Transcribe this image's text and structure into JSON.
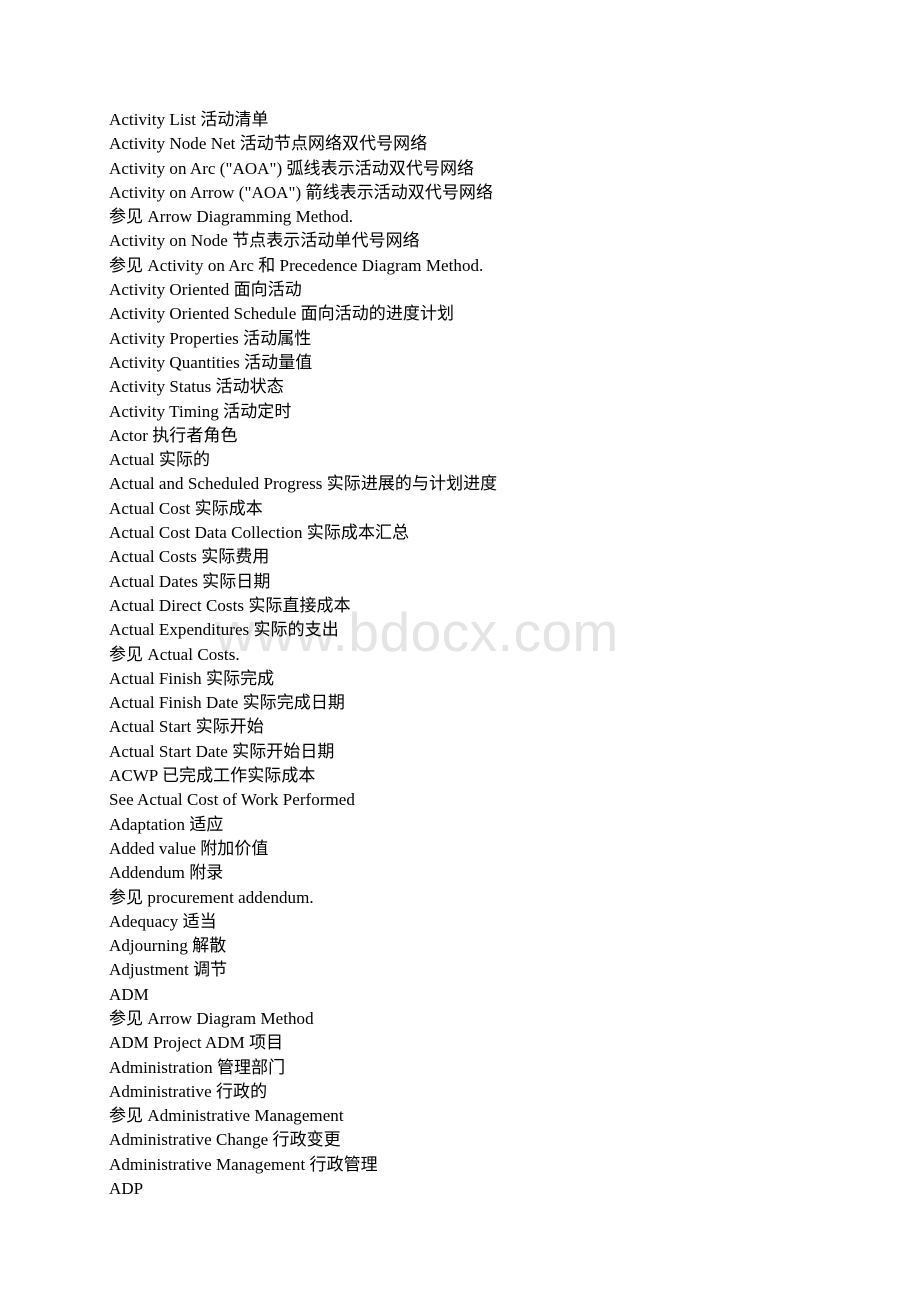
{
  "document": {
    "type": "bilingual-glossary",
    "language_pair": "English-Chinese",
    "section_letter": "A"
  },
  "watermark": {
    "text": "www.bdocx.com",
    "color": "#e4e4e4"
  },
  "glossary": {
    "entries": [
      "Activity List 活动清单",
      "Activity Node Net 活动节点网络双代号网络",
      "Activity on Arc (\"AOA\") 弧线表示活动双代号网络",
      "Activity on Arrow (\"AOA\") 箭线表示活动双代号网络",
      "参见 Arrow Diagramming Method.",
      "Activity on Node 节点表示活动单代号网络",
      "参见 Activity on Arc 和 Precedence Diagram Method.",
      "Activity Oriented 面向活动",
      "Activity Oriented Schedule 面向活动的进度计划",
      "Activity Properties 活动属性",
      "Activity Quantities 活动量值",
      "Activity Status 活动状态",
      "Activity Timing 活动定时",
      "Actor 执行者角色",
      "Actual 实际的",
      "Actual and Scheduled Progress 实际进展的与计划进度",
      "Actual Cost 实际成本",
      "Actual Cost Data Collection 实际成本汇总",
      "Actual Costs 实际费用",
      "Actual Dates 实际日期",
      "Actual Direct Costs 实际直接成本",
      "Actual Expenditures 实际的支出",
      "参见 Actual Costs.",
      "Actual Finish 实际完成",
      "Actual Finish Date 实际完成日期",
      "Actual Start 实际开始",
      "Actual Start Date 实际开始日期",
      "ACWP 已完成工作实际成本",
      "See Actual Cost of Work Performed",
      "Adaptation 适应",
      "Added value 附加价值",
      "Addendum 附录",
      "参见 procurement addendum.",
      "Adequacy 适当",
      "Adjourning 解散",
      "Adjustment 调节",
      "ADM",
      "参见 Arrow Diagram Method",
      "ADM Project ADM 项目",
      "Administration 管理部门",
      "Administrative 行政的",
      "参见 Administrative Management",
      "Administrative Change 行政变更",
      "Administrative Management 行政管理",
      "ADP"
    ]
  }
}
